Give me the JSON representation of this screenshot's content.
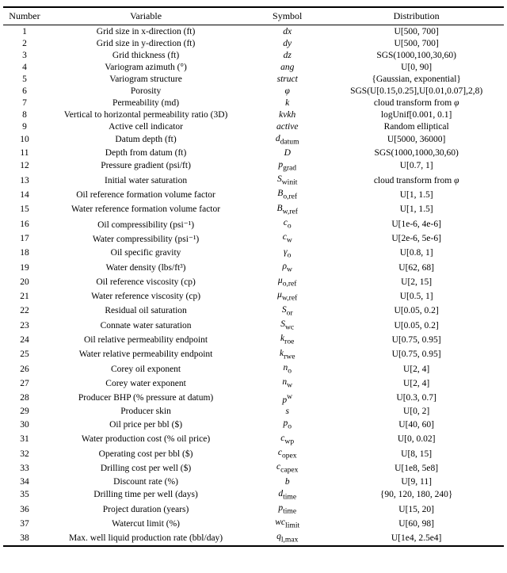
{
  "table": {
    "headers": [
      "Number",
      "Variable",
      "Symbol",
      "Distribution"
    ],
    "rows": [
      {
        "num": "1",
        "variable": "Grid size in x-direction (ft)",
        "symbol": "dx",
        "symbol_italic": true,
        "distribution": "U[500, 700]"
      },
      {
        "num": "2",
        "variable": "Grid size in y-direction (ft)",
        "symbol": "dy",
        "symbol_italic": true,
        "distribution": "U[500, 700]"
      },
      {
        "num": "3",
        "variable": "Grid thickness (ft)",
        "symbol": "dz",
        "symbol_italic": true,
        "distribution": "SGS(1000,100,30,60)"
      },
      {
        "num": "4",
        "variable": "Variogram azimuth (°)",
        "symbol": "ang",
        "symbol_italic": true,
        "distribution": "U[0, 90]"
      },
      {
        "num": "5",
        "variable": "Variogram structure",
        "symbol": "struct",
        "symbol_italic": true,
        "distribution": "{Gaussian, exponential}"
      },
      {
        "num": "6",
        "variable": "Porosity",
        "symbol": "φ",
        "symbol_italic": true,
        "distribution": "SGS(U[0.15,0.25],U[0.01,0.07],2,8)"
      },
      {
        "num": "7",
        "variable": "Permeability (md)",
        "symbol": "k",
        "symbol_italic": true,
        "distribution": "cloud transform from φ"
      },
      {
        "num": "8",
        "variable": "Vertical to horizontal permeability ratio (3D)",
        "symbol": "kvkh",
        "symbol_italic": true,
        "distribution": "logUnif[0.001, 0.1]"
      },
      {
        "num": "9",
        "variable": "Active cell indicator",
        "symbol": "active",
        "symbol_italic": true,
        "distribution": "Random elliptical"
      },
      {
        "num": "10",
        "variable": "Datum depth (ft)",
        "symbol": "d_datum",
        "symbol_italic": true,
        "distribution": "U[5000, 36000]"
      },
      {
        "num": "11",
        "variable": "Depth from datum (ft)",
        "symbol": "D",
        "symbol_italic": true,
        "distribution": "SGS(1000,1000,30,60)"
      },
      {
        "num": "12",
        "variable": "Pressure gradient (psi/ft)",
        "symbol": "p_grad",
        "symbol_italic": true,
        "distribution": "U[0.7, 1]"
      },
      {
        "num": "13",
        "variable": "Initial water saturation",
        "symbol": "S_winit",
        "symbol_italic": true,
        "distribution": "cloud transform from φ"
      },
      {
        "num": "14",
        "variable": "Oil reference formation volume factor",
        "symbol": "B_o,ref",
        "symbol_italic": true,
        "distribution": "U[1, 1.5]"
      },
      {
        "num": "15",
        "variable": "Water reference formation volume factor",
        "symbol": "B_w,ref",
        "symbol_italic": true,
        "distribution": "U[1, 1.5]"
      },
      {
        "num": "16",
        "variable": "Oil compressibility (psi⁻¹)",
        "symbol": "c_o",
        "symbol_italic": true,
        "distribution": "U[1e-6, 4e-6]"
      },
      {
        "num": "17",
        "variable": "Water compressibility (psi⁻¹)",
        "symbol": "c_w",
        "symbol_italic": true,
        "distribution": "U[2e-6, 5e-6]"
      },
      {
        "num": "18",
        "variable": "Oil specific gravity",
        "symbol": "γ_o",
        "symbol_italic": true,
        "distribution": "U[0.8, 1]"
      },
      {
        "num": "19",
        "variable": "Water density (lbs/ft³)",
        "symbol": "ρ_w",
        "symbol_italic": true,
        "distribution": "U[62, 68]"
      },
      {
        "num": "20",
        "variable": "Oil reference viscosity (cp)",
        "symbol": "μ_o,ref",
        "symbol_italic": true,
        "distribution": "U[2, 15]"
      },
      {
        "num": "21",
        "variable": "Water reference viscosity (cp)",
        "symbol": "μ_w,ref",
        "symbol_italic": true,
        "distribution": "U[0.5, 1]"
      },
      {
        "num": "22",
        "variable": "Residual oil saturation",
        "symbol": "S_or",
        "symbol_italic": true,
        "distribution": "U[0.05, 0.2]"
      },
      {
        "num": "23",
        "variable": "Connate water saturation",
        "symbol": "S_wc",
        "symbol_italic": true,
        "distribution": "U[0.05, 0.2]"
      },
      {
        "num": "24",
        "variable": "Oil relative permeability endpoint",
        "symbol": "k_roe",
        "symbol_italic": true,
        "distribution": "U[0.75, 0.95]"
      },
      {
        "num": "25",
        "variable": "Water relative permeability endpoint",
        "symbol": "k_rwe",
        "symbol_italic": true,
        "distribution": "U[0.75, 0.95]"
      },
      {
        "num": "26",
        "variable": "Corey oil exponent",
        "symbol": "n_o",
        "symbol_italic": true,
        "distribution": "U[2, 4]"
      },
      {
        "num": "27",
        "variable": "Corey water exponent",
        "symbol": "n_w",
        "symbol_italic": true,
        "distribution": "U[2, 4]"
      },
      {
        "num": "28",
        "variable": "Producer BHP (% pressure at datum)",
        "symbol": "p^w",
        "symbol_italic": true,
        "distribution": "U[0.3, 0.7]"
      },
      {
        "num": "29",
        "variable": "Producer skin",
        "symbol": "s",
        "symbol_italic": true,
        "distribution": "U[0, 2]"
      },
      {
        "num": "30",
        "variable": "Oil price per bbl ($)",
        "symbol": "p_o",
        "symbol_italic": true,
        "distribution": "U[40, 60]"
      },
      {
        "num": "31",
        "variable": "Water production cost (% oil price)",
        "symbol": "c_wp",
        "symbol_italic": true,
        "distribution": "U[0, 0.02]"
      },
      {
        "num": "32",
        "variable": "Operating cost per bbl ($)",
        "symbol": "c_opex",
        "symbol_italic": true,
        "distribution": "U[8, 15]"
      },
      {
        "num": "33",
        "variable": "Drilling cost per well ($)",
        "symbol": "c_capex",
        "symbol_italic": true,
        "distribution": "U[1e8, 5e8]"
      },
      {
        "num": "34",
        "variable": "Discount rate (%)",
        "symbol": "b",
        "symbol_italic": true,
        "distribution": "U[9, 11]"
      },
      {
        "num": "35",
        "variable": "Drilling time per well (days)",
        "symbol": "d_time",
        "symbol_italic": true,
        "distribution": "{90, 120, 180, 240}"
      },
      {
        "num": "36",
        "variable": "Project duration (years)",
        "symbol": "p_time",
        "symbol_italic": true,
        "distribution": "U[15, 20]"
      },
      {
        "num": "37",
        "variable": "Watercut limit (%)",
        "symbol": "wc_limit",
        "symbol_italic": true,
        "distribution": "U[60, 98]"
      },
      {
        "num": "38",
        "variable": "Max. well liquid production rate (bbl/day)",
        "symbol": "q_l,max",
        "symbol_italic": true,
        "distribution": "U[1e4, 2.5e4]"
      }
    ]
  }
}
